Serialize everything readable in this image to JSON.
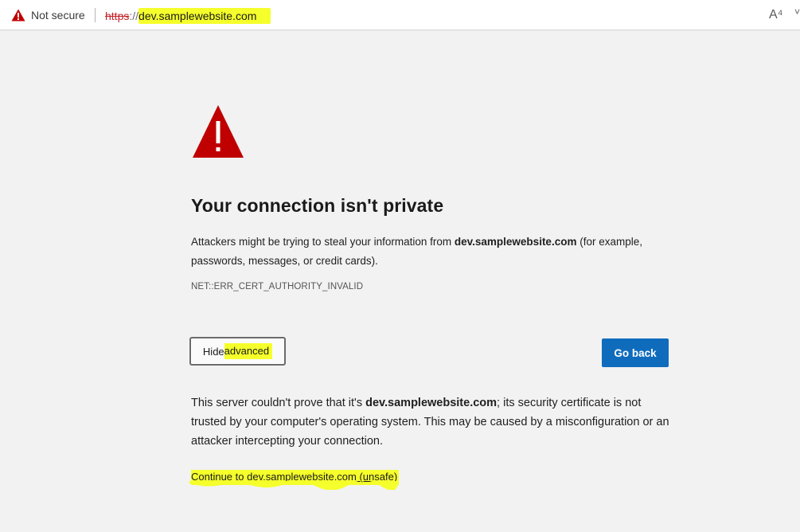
{
  "address_bar": {
    "security_label": "Not secure",
    "url_scheme": "https",
    "url_separator": "://",
    "url_host": "dev.samplewebsite.com",
    "read_aloud_glyph": "A⁴",
    "more_glyph": "˅"
  },
  "page": {
    "title": "Your connection isn't private",
    "description_prefix": "Attackers might be trying to steal your information from ",
    "description_host": "dev.samplewebsite.com",
    "description_suffix": " (for example, passwords, messages, or credit cards).",
    "error_code": "NET::ERR_CERT_AUTHORITY_INVALID",
    "hide_advanced_prefix": "Hide ",
    "hide_advanced_highlight": "advanced",
    "go_back_label": "Go back",
    "details_prefix": "This server couldn't prove that it's ",
    "details_host": "dev.samplewebsite.com",
    "details_suffix": "; its security certificate is not trusted by your computer's operating system. This may be caused by a misconfiguration or an attacker intercepting your connection.",
    "proceed_link": "Continue to dev.samplewebsite.com (unsafe)"
  },
  "colors": {
    "warning_red": "#c00000",
    "primary_button": "#0f6cbd",
    "highlight": "#f5ff2b",
    "background": "#f2f2f2"
  },
  "icons": [
    "warning-triangle-icon",
    "read-aloud-icon",
    "chevron-down-icon"
  ]
}
